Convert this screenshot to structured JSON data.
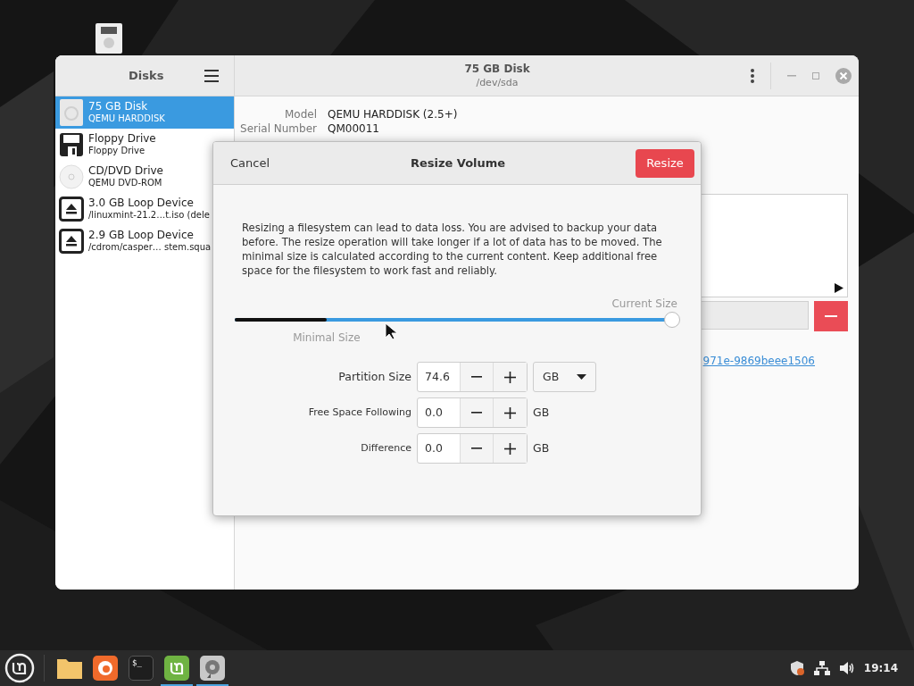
{
  "sidebar": {
    "title": "Disks",
    "items": [
      {
        "kind": "harddisk",
        "name": "75 GB Disk",
        "detail": "QEMU HARDDISK",
        "selected": true
      },
      {
        "kind": "floppy",
        "name": "Floppy Drive",
        "detail": "Floppy Drive",
        "selected": false
      },
      {
        "kind": "optical",
        "name": "CD/DVD Drive",
        "detail": "QEMU DVD-ROM",
        "selected": false
      },
      {
        "kind": "loop",
        "name": "3.0 GB Loop Device",
        "detail": "/linuxmint-21.2…t.iso (dele",
        "selected": false
      },
      {
        "kind": "loop",
        "name": "2.9 GB Loop Device",
        "detail": "/cdrom/casper… stem.squa",
        "selected": false
      }
    ]
  },
  "header": {
    "title": "75 GB Disk",
    "subtitle": "/dev/sda"
  },
  "details": [
    {
      "label": "Model",
      "value": "QEMU HARDDISK (2.5+)"
    },
    {
      "label": "Serial Number",
      "value": "QM00011"
    }
  ],
  "volume_link": "971e-9869beee1506",
  "dialog": {
    "cancel": "Cancel",
    "title": "Resize Volume",
    "confirm": "Resize",
    "message": "Resizing a filesystem can lead to data loss. You are advised to backup your data before. The resize operation will take longer if a lot of data has to be moved. The minimal size is calculated according to the current content. Keep additional free space for the filesystem to work fast and reliably.",
    "slider": {
      "level": 1,
      "current_label": "Current Size",
      "minimal_label": "Minimal Size",
      "minimum": {
        "level": 0.21
      }
    },
    "fields": [
      {
        "kind": "dropdown",
        "label": "Partition Size",
        "value": "74.6",
        "unit": "GB"
      },
      {
        "kind": "text",
        "label": "Free Space Following",
        "value": "0.0",
        "unit": "GB"
      },
      {
        "kind": "text",
        "label": "Difference",
        "value": "0.0",
        "unit": "GB"
      }
    ]
  },
  "taskbar": {
    "apps": [
      {
        "kind": "folder",
        "active": false
      },
      {
        "kind": "browser",
        "active": false
      },
      {
        "kind": "terminal",
        "active": false,
        "text": "$_"
      },
      {
        "kind": "mint",
        "active": true
      },
      {
        "kind": "disks",
        "active": true
      }
    ],
    "clock": "19:14"
  }
}
